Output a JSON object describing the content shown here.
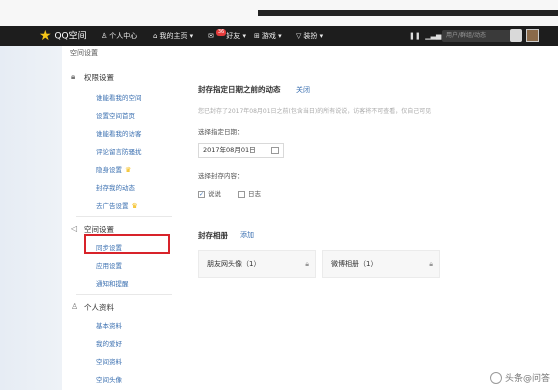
{
  "nav": {
    "logo": "QQ空间",
    "personal_center": "个人中心",
    "my_home": "我的主页",
    "friends": "好友",
    "friends_badge": "36",
    "games": "游戏",
    "decoration": "装扮",
    "search_placeholder": "用户/群组/动态"
  },
  "page_title": "空间设置",
  "sidebar": {
    "permission_section": "权限设置",
    "permission_items": [
      "谁能看我的空间",
      "设置空间首页",
      "谁能看我的访客",
      "评论留言防骚扰",
      "隐身设置",
      "封存我的动态",
      "去广告设置"
    ],
    "space_section": "空间设置",
    "space_items": [
      "同步设置",
      "应用设置",
      "通知和提醒"
    ],
    "profile_section": "个人资料",
    "profile_items": [
      "基本资料",
      "我的爱好",
      "空间资料",
      "空间头像"
    ]
  },
  "main": {
    "title": "封存指定日期之前的动态",
    "close": "关闭",
    "description": "您已封存了2017年08月01日之前(包含当日)的所有说说，访客将不可查看，仅自己可见",
    "date_label": "选择指定日期：",
    "date_value": "2017年08月01日",
    "content_label": "选择封存内容：",
    "option_shuoshuo": "说说",
    "option_shuoshuo_checked": true,
    "option_diary": "日志",
    "option_diary_checked": false,
    "albums_title": "封存相册",
    "albums_add": "添加",
    "albums": [
      "朋友网头像（1）",
      "微博相册（1）"
    ]
  },
  "watermark": "头条@问答"
}
